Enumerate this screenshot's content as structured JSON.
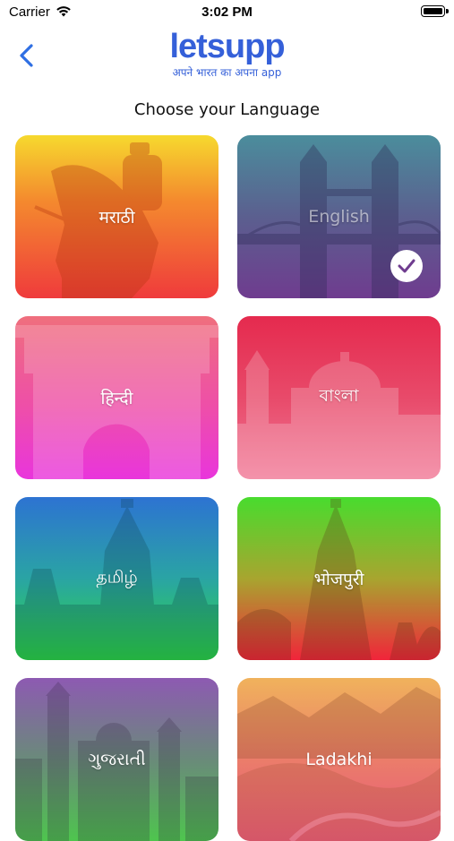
{
  "status_bar": {
    "carrier": "Carrier",
    "time": "3:02 PM"
  },
  "header": {
    "logo_text": "letsupp",
    "tagline": "अपने भारत का अपना app"
  },
  "page_title": "Choose your Language",
  "languages": [
    {
      "label": "मराठी",
      "selected": false
    },
    {
      "label": "English",
      "selected": true
    },
    {
      "label": "हिन्दी",
      "selected": false
    },
    {
      "label": "বাংলা",
      "selected": false
    },
    {
      "label": "தமிழ்",
      "selected": false
    },
    {
      "label": "भोजपुरी",
      "selected": false
    },
    {
      "label": "ગુજરાતી",
      "selected": false
    },
    {
      "label": "Ladakhi",
      "selected": false
    }
  ],
  "colors": {
    "brand": "#3560d9",
    "back_arrow": "#2f6fe3"
  },
  "icons": {
    "back": "chevron-left-icon",
    "selected": "checkmark-icon",
    "wifi": "wifi-icon",
    "battery": "battery-icon"
  }
}
